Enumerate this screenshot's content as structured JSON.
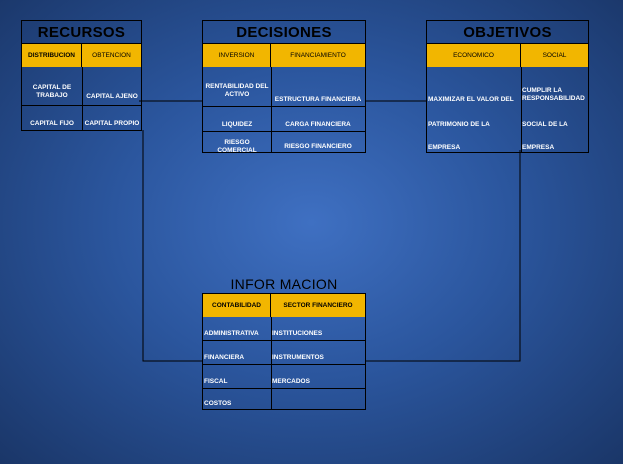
{
  "recursos": {
    "title": "RECURSOS",
    "headers": [
      "DISTRIBUCION",
      "OBTENCION"
    ],
    "rows": [
      [
        "CAPITAL DE TRABAJO",
        "CAPITAL AJENO"
      ],
      [
        "CAPITAL FIJO",
        "CAPITAL PROPIO"
      ]
    ]
  },
  "decisiones": {
    "title": "DECISIONES",
    "headers": [
      "INVERSION",
      "FINANCIAMIENTO"
    ],
    "rows": [
      [
        "RENTABILIDAD DEL ACTIVO",
        "ESTRUCTURA FINANCIERA"
      ],
      [
        "LIQUIDEZ",
        "CARGA FINANCIERA"
      ],
      [
        "RIESGO COMERCIAL",
        "RIESGO FINANCIERO"
      ]
    ]
  },
  "objetivos": {
    "title": "OBJETIVOS",
    "headers": [
      "ECONOMICO",
      "SOCIAL"
    ],
    "col1": [
      "MAXIMIZAR EL VALOR DEL",
      "PATRIMONIO DE LA",
      "EMPRESA"
    ],
    "col2": [
      "CUMPLIR  LA RESPONSABILIDAD",
      "SOCIAL DE LA",
      "EMPRESA"
    ]
  },
  "informacion": {
    "title": "INFOR MACION",
    "headers": [
      "CONTABILIDAD",
      "SECTOR FINANCIERO"
    ],
    "rows": [
      [
        "ADMINISTRATIVA",
        "INSTITUCIONES"
      ],
      [
        "FINANCIERA",
        "INSTRUMENTOS"
      ],
      [
        "FISCAL",
        "MERCADOS"
      ],
      [
        "COSTOS",
        ""
      ]
    ]
  }
}
